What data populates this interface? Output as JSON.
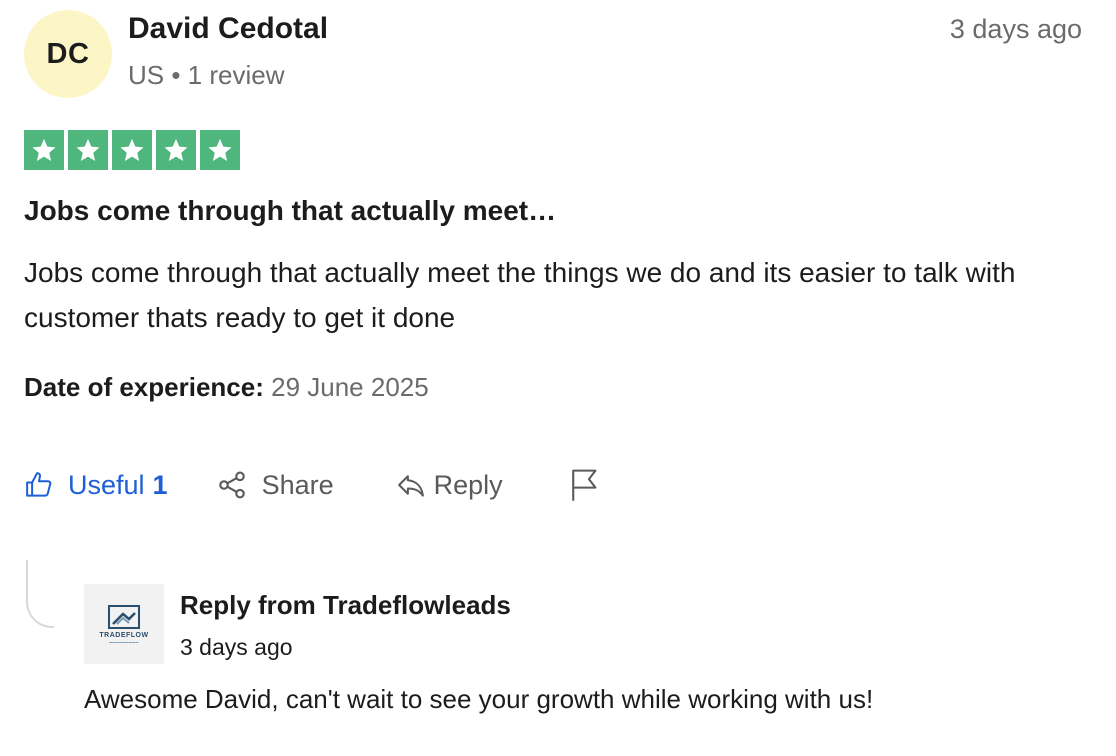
{
  "reviewer": {
    "initials": "DC",
    "name": "David Cedotal",
    "meta": "US • 1 review"
  },
  "review": {
    "posted": "3 days ago",
    "rating": 5,
    "rating_color": "#4fb77e",
    "title": "Jobs come through that actually meet…",
    "body": "Jobs come through that actually meet the things we do and its easier to talk with customer thats ready to get it done",
    "experience_label": "Date of experience:",
    "experience_date": "29 June 2025"
  },
  "actions": {
    "useful_label": "Useful",
    "useful_count": "1",
    "share_label": "Share",
    "reply_label": "Reply",
    "useful_icon": "thumbs-up-icon",
    "share_icon": "share-icon",
    "reply_icon": "reply-arrow-icon",
    "flag_icon": "flag-icon"
  },
  "company_reply": {
    "logo_text": "TRADEFLOW",
    "heading": "Reply from Tradeflowleads",
    "posted": "3 days ago",
    "body": "Awesome David, can't wait to see your growth while working with us!"
  }
}
